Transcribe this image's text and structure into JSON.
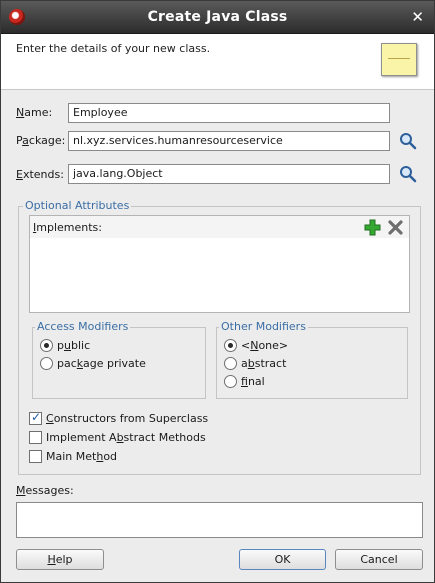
{
  "window": {
    "title": "Create Java Class"
  },
  "header": {
    "description": "Enter the details of your new class."
  },
  "form": {
    "name_label_u": "N",
    "name_label_rest": "ame:",
    "name_value": "Employee",
    "package_label_a": "P",
    "package_label_u": "a",
    "package_label_rest": "ckage:",
    "package_value": "nl.xyz.services.humanresourceservice",
    "extends_label_u": "E",
    "extends_label_rest": "xtends:",
    "extends_value": "java.lang.Object"
  },
  "optional": {
    "title": "Optional Attributes",
    "implements_u": "I",
    "implements_rest": "mplements:",
    "implements_items": []
  },
  "access": {
    "title": "Access Modifiers",
    "public_a": "p",
    "public_u": "u",
    "public_rest": "blic",
    "pkg_a": "pac",
    "pkg_u": "k",
    "pkg_rest": "age private",
    "selected": "public"
  },
  "other": {
    "title": "Other Modifiers",
    "none_a": "<",
    "none_u": "N",
    "none_rest": "one>",
    "abstract_a": "a",
    "abstract_u": "b",
    "abstract_rest": "stract",
    "final_a": "",
    "final_u": "f",
    "final_rest": "inal",
    "selected": "<None>"
  },
  "checks": {
    "ctor_u": "C",
    "ctor_rest": "onstructors from Superclass",
    "ctor_checked": true,
    "abs_a": "Implement A",
    "abs_u": "b",
    "abs_rest": "stract Methods",
    "abs_checked": false,
    "main_a": "Main Met",
    "main_u": "h",
    "main_rest": "od",
    "main_checked": false
  },
  "messages": {
    "label_u": "M",
    "label_rest": "essages:",
    "text": ""
  },
  "buttons": {
    "help_u": "H",
    "help_rest": "elp",
    "ok": "OK",
    "cancel": "Cancel"
  },
  "colors": {
    "accent": "#3a6ea5",
    "titlebar": "#2c2c2c",
    "add": "#2e9a2e",
    "remove": "#707070"
  }
}
